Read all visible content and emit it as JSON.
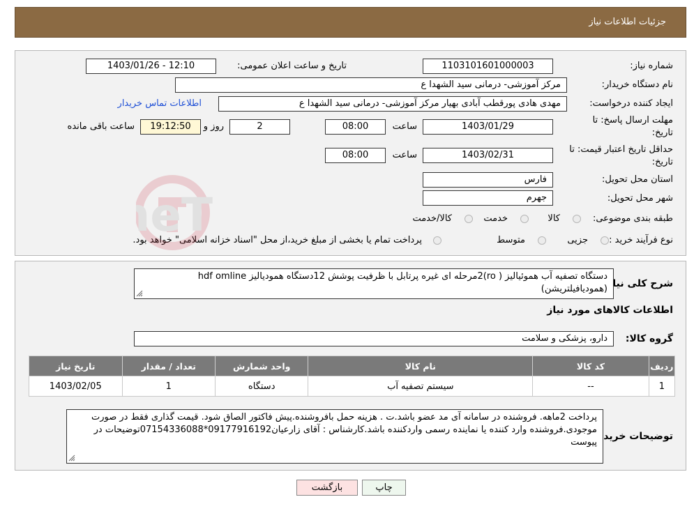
{
  "header": {
    "title": "جزئیات اطلاعات نیاز"
  },
  "form": {
    "need_number_label": "شماره نیاز:",
    "need_number": "1103101601000003",
    "announce_label": "تاریخ و ساعت اعلان عمومی:",
    "announce_value": "1403/01/26 - 12:10",
    "buyer_org_label": "نام دستگاه خریدار:",
    "buyer_org": "مرکز آموزشی- درمانی سید الشهدا ع",
    "requester_label": "ایجاد کننده درخواست:",
    "requester": "مهدی هادی پورقطب آبادی بهیار مرکز آموزشی- درمانی سید الشهدا ع",
    "contact_link": "اطلاعات تماس خریدار",
    "deadline_label_1": "مهلت ارسال پاسخ: تا",
    "deadline_label_2": "تاریخ:",
    "deadline_date": "1403/01/29",
    "time_label": "ساعت",
    "deadline_time": "08:00",
    "days_value": "2",
    "days_label": "روز و",
    "remaining_time": "19:12:50",
    "remaining_label": "ساعت باقی مانده",
    "price_validity_label_1": "حداقل تاریخ اعتبار قیمت: تا",
    "price_validity_label_2": "تاریخ:",
    "price_validity_date": "1403/02/31",
    "price_validity_time": "08:00",
    "province_label": "استان محل تحویل:",
    "province": "فارس",
    "city_label": "شهر محل تحویل:",
    "city": "جهرم",
    "category_label": "طبقه بندی موضوعی:",
    "category_options": [
      "کالا",
      "خدمت",
      "کالا/خدمت"
    ],
    "purchase_type_label": "نوع فرآیند خرید :",
    "purchase_options": [
      "جزیی",
      "متوسط"
    ],
    "purchase_note": "پرداخت تمام یا بخشی از مبلغ خرید،از محل \"اسناد خزانه اسلامی\" خواهد بود."
  },
  "watermark": {
    "text": "AriaTender.neT"
  },
  "details": {
    "description_label": "شرح کلی نیاز:",
    "description": "دستگاه تصفیه آب هموئیالیز ( ro)2مرحله ای غیره پرتابل با ظرفیت پوشش 12دستگاه همودیالیز hdf omline (همودیافیلتریشن)",
    "goods_info_title": "اطلاعات کالاهای مورد نیاز",
    "goods_group_label": "گروه کالا:",
    "goods_group": "دارو، پزشکی و سلامت",
    "table": {
      "headers": [
        "ردیف",
        "کد کالا",
        "نام کالا",
        "واحد شمارش",
        "تعداد / مقدار",
        "تاریخ نیاز"
      ],
      "rows": [
        [
          "1",
          "--",
          "سیستم تصفیه آب",
          "دستگاه",
          "1",
          "1403/02/05"
        ]
      ]
    },
    "buyer_notes_label": "توضیحات خریدار:",
    "buyer_notes": "پرداخت 2ماهه. فروشنده در سامانه آی مد عضو باشد.ت . هزینه حمل بافروشنده.پیش فاکتور الصاق شود. قیمت گذاری فقط در صورت موجودی.فروشنده وارد کننده یا نماینده رسمی واردکننده باشد.کارشناس : آقای زارعیان09177916192*07154336088توضیحات در پیوست"
  },
  "buttons": {
    "print": "چاپ",
    "back": "بازگشت"
  }
}
